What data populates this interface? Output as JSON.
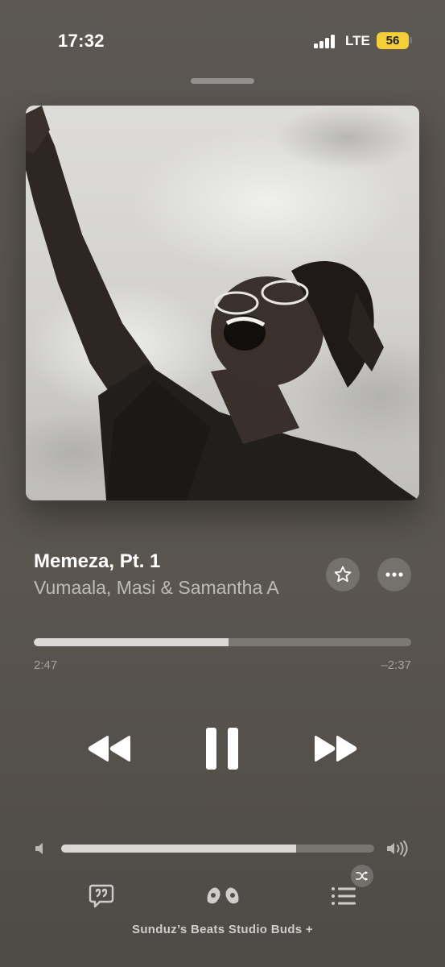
{
  "status_bar": {
    "time": "17:32",
    "network": "LTE",
    "battery": "56",
    "battery_color": "#f4cf3a"
  },
  "now_playing": {
    "title": "Memeza, Pt. 1",
    "artist": "Vumaala, Masi & Samantha A",
    "artwork_icon": "album-art-image",
    "favorite_icon": "star-icon",
    "more_icon": "ellipsis-icon"
  },
  "playback": {
    "elapsed": "2:47",
    "remaining": "–2:37",
    "progress_fraction": 0.515,
    "state": "playing",
    "controls": [
      "rewind-icon",
      "pause-icon",
      "fast-forward-icon"
    ]
  },
  "volume": {
    "level_fraction": 0.75,
    "low_icon": "speaker-low-icon",
    "high_icon": "speaker-high-icon"
  },
  "bottom_bar": {
    "lyrics_icon": "lyrics-icon",
    "airplay_icon": "earbuds-icon",
    "queue_icon": "queue-list-icon",
    "shuffle_icon": "shuffle-icon",
    "device_name": "Sunduz’s Beats Studio Buds +"
  }
}
